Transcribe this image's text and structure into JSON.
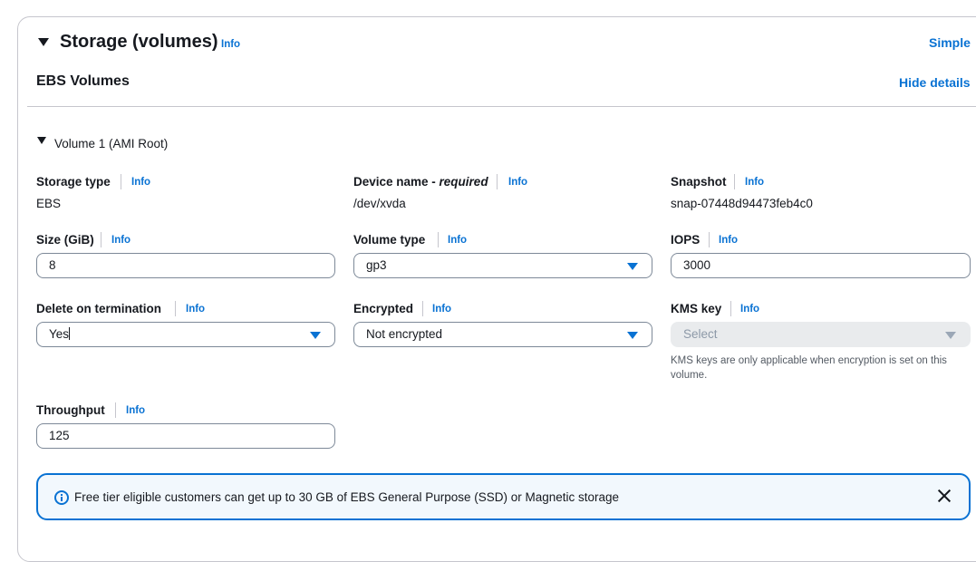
{
  "header": {
    "title": "Storage (volumes)",
    "info": "Info",
    "simple_link": "Simple"
  },
  "ebs": {
    "heading": "EBS Volumes",
    "hide_details": "Hide details"
  },
  "volume": {
    "label": "Volume 1 (AMI Root)"
  },
  "fields": {
    "storage_type": {
      "label": "Storage type",
      "info": "Info",
      "value": "EBS"
    },
    "device_name": {
      "label": "Device name - ",
      "required": "required",
      "info": "Info",
      "value": "/dev/xvda"
    },
    "snapshot": {
      "label": "Snapshot",
      "info": "Info",
      "value": "snap-07448d94473feb4c0"
    },
    "size": {
      "label": "Size (GiB)",
      "info": "Info",
      "value": "8"
    },
    "volume_type": {
      "label": "Volume type",
      "info": "Info",
      "value": "gp3"
    },
    "iops": {
      "label": "IOPS",
      "info": "Info",
      "value": "3000"
    },
    "delete_on_termination": {
      "label": "Delete on termination",
      "info": "Info",
      "value": "Yes"
    },
    "encrypted": {
      "label": "Encrypted",
      "info": "Info",
      "value": "Not encrypted"
    },
    "kms_key": {
      "label": "KMS key",
      "info": "Info",
      "placeholder": "Select",
      "hint": "KMS keys are only applicable when encryption is set on this volume."
    },
    "throughput": {
      "label": "Throughput",
      "info": "Info",
      "value": "125"
    }
  },
  "alert": {
    "text": "Free tier eligible customers can get up to 30 GB of EBS General Purpose (SSD) or Magnetic storage"
  },
  "colors": {
    "link": "#0972d3",
    "alert_bg": "#f2f8fd",
    "border": "#7d8998"
  }
}
